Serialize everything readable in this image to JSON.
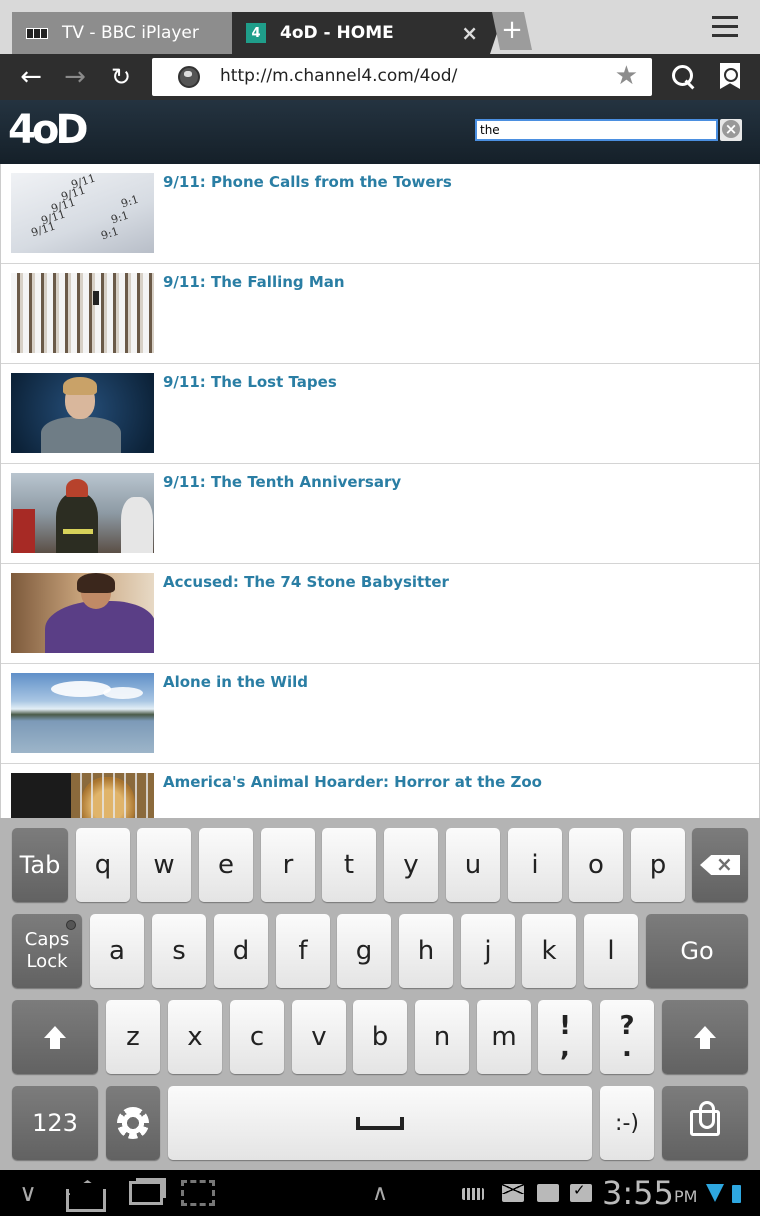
{
  "browser": {
    "tabs": [
      {
        "label": "TV - BBC iPlayer",
        "icon": "bbc-icon"
      },
      {
        "label": "4oD - HOME",
        "icon": "channel4-icon",
        "active": true
      }
    ],
    "url": "http://m.channel4.com/4od/",
    "new_tab": "+",
    "close_tab": "×"
  },
  "site": {
    "logo": "4oD",
    "search_value": "the"
  },
  "results": [
    {
      "title": "9/11: Phone Calls from the Towers"
    },
    {
      "title": "9/11: The Falling Man"
    },
    {
      "title": "9/11: The Lost Tapes"
    },
    {
      "title": "9/11: The Tenth Anniversary"
    },
    {
      "title": "Accused: The 74 Stone Babysitter"
    },
    {
      "title": "Alone in the Wild"
    },
    {
      "title": "America's Animal Hoarder: Horror at the Zoo"
    }
  ],
  "phone_thumb_numbers": [
    "9/11",
    "9/11",
    "9/11",
    "9/11",
    "9/11",
    "9:1",
    "9:1",
    "9:1"
  ],
  "keyboard": {
    "tab": "Tab",
    "row1": [
      "q",
      "w",
      "e",
      "r",
      "t",
      "y",
      "u",
      "i",
      "o",
      "p"
    ],
    "caps_line1": "Caps",
    "caps_line2": "Lock",
    "row2": [
      "a",
      "s",
      "d",
      "f",
      "g",
      "h",
      "j",
      "k",
      "l"
    ],
    "go": "Go",
    "row3": [
      "z",
      "x",
      "c",
      "v",
      "b",
      "n",
      "m"
    ],
    "punct1_top": "!",
    "punct1_bottom": ",",
    "punct2_top": "?",
    "punct2_bottom": ".",
    "num": "123",
    "smiley": ":-)"
  },
  "status": {
    "time": "3:55",
    "ampm": "PM"
  }
}
